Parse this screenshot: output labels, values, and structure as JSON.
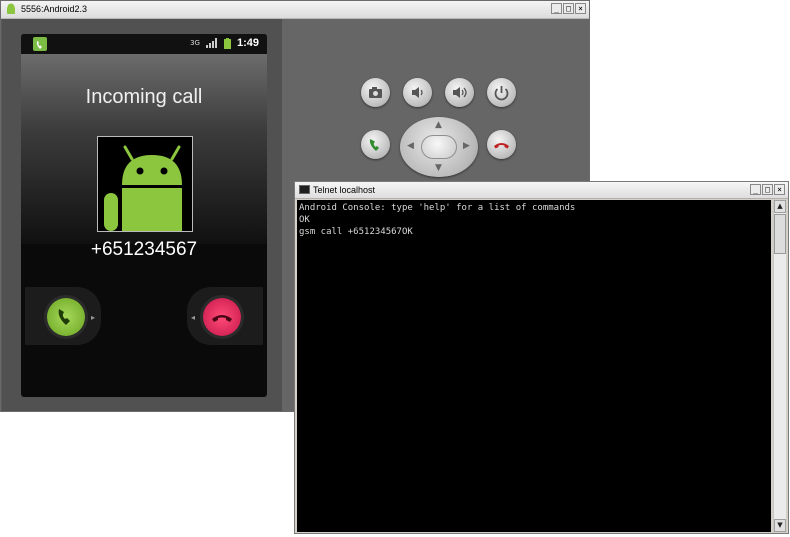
{
  "emulator": {
    "title": "5556:Android2.3",
    "window_buttons": [
      "_",
      "□",
      "×"
    ],
    "status_bar": {
      "time": "1:49",
      "signal_text": "3G"
    },
    "call_screen": {
      "heading": "Incoming call",
      "caller_number": "+651234567",
      "answer_color": "#8cc63f",
      "decline_color": "#e8185a"
    },
    "controls": {
      "icons": [
        "camera-icon",
        "volume-down-icon",
        "volume-up-icon",
        "power-icon",
        "call-icon",
        "end-call-icon"
      ]
    }
  },
  "telnet": {
    "title": "Telnet localhost",
    "window_buttons": [
      "_",
      "□",
      "×"
    ],
    "console_lines": [
      "Android Console: type 'help' for a list of commands",
      "OK",
      "gsm call +651234567OK"
    ]
  }
}
